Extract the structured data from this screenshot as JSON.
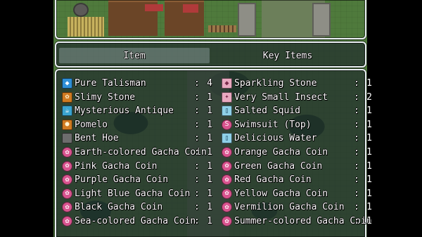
{
  "menu": {
    "tabs": [
      {
        "label": "Item"
      },
      {
        "label": "Key Items"
      }
    ],
    "separator": ":",
    "left_column": [
      {
        "name": "Pure Talisman",
        "qty": "4",
        "icon": "talisman-icon",
        "glyph": "◆",
        "color_class": "blue"
      },
      {
        "name": "Slimy Stone",
        "qty": "1",
        "icon": "slimy-stone-icon",
        "glyph": "✿",
        "color_class": "orange"
      },
      {
        "name": "Mysterious Antique",
        "qty": "1",
        "icon": "teapot-icon",
        "glyph": "☕",
        "color_class": "teal"
      },
      {
        "name": "Pomelo",
        "qty": "1",
        "icon": "fruit-icon",
        "glyph": "●",
        "color_class": "orange"
      },
      {
        "name": "Bent Hoe",
        "qty": "1",
        "icon": "hoe-icon",
        "glyph": "",
        "color_class": "grey"
      },
      {
        "name": "Earth-colored Gacha Coin",
        "qty": "1",
        "icon": "gacha-coin-icon",
        "glyph": "✿",
        "color_class": "coin"
      },
      {
        "name": "Pink Gacha Coin",
        "qty": "1",
        "icon": "gacha-coin-icon",
        "glyph": "✿",
        "color_class": "coin"
      },
      {
        "name": "Purple Gacha Coin",
        "qty": "1",
        "icon": "gacha-coin-icon",
        "glyph": "✿",
        "color_class": "coin"
      },
      {
        "name": "Light Blue Gacha Coin",
        "qty": "1",
        "icon": "gacha-coin-icon",
        "glyph": "✿",
        "color_class": "coin"
      },
      {
        "name": "Black Gacha Coin",
        "qty": "1",
        "icon": "gacha-coin-icon",
        "glyph": "✿",
        "color_class": "coin"
      },
      {
        "name": "Sea-colored Gacha Coin",
        "qty": "1",
        "icon": "gacha-coin-icon",
        "glyph": "✿",
        "color_class": "coin"
      }
    ],
    "right_column": [
      {
        "name": "Sparkling Stone",
        "qty": "1",
        "icon": "sparkling-stone-icon",
        "glyph": "◆",
        "color_class": "pinkbox"
      },
      {
        "name": "Very Small Insect",
        "qty": "2",
        "icon": "insect-icon",
        "glyph": "✦",
        "color_class": "pinkbox"
      },
      {
        "name": "Salted Squid",
        "qty": "1",
        "icon": "jar-icon",
        "glyph": "▯",
        "color_class": "bottle"
      },
      {
        "name": "Swimsuit (Top)",
        "qty": "1",
        "icon": "swimsuit-icon",
        "glyph": "S",
        "color_class": "coin"
      },
      {
        "name": "Delicious Water",
        "qty": "1",
        "icon": "bottle-icon",
        "glyph": "▯",
        "color_class": "bottle"
      },
      {
        "name": "Orange Gacha Coin",
        "qty": "1",
        "icon": "gacha-coin-icon",
        "glyph": "✿",
        "color_class": "coin"
      },
      {
        "name": "Green Gacha Coin",
        "qty": "1",
        "icon": "gacha-coin-icon",
        "glyph": "✿",
        "color_class": "coin"
      },
      {
        "name": "Red Gacha Coin",
        "qty": "1",
        "icon": "gacha-coin-icon",
        "glyph": "✿",
        "color_class": "coin"
      },
      {
        "name": "Yellow Gacha Coin",
        "qty": "1",
        "icon": "gacha-coin-icon",
        "glyph": "✿",
        "color_class": "coin"
      },
      {
        "name": "Vermilion Gacha Coin",
        "qty": "1",
        "icon": "gacha-coin-icon",
        "glyph": "✿",
        "color_class": "coin"
      },
      {
        "name": "Summer-colored Gacha Coin",
        "qty": "1",
        "icon": "gacha-coin-icon",
        "glyph": "✿",
        "color_class": "coin"
      }
    ]
  },
  "colors": {
    "window_border": "#e9eef2",
    "window_fill": "#1a222c",
    "selected_tab": "#becdd7",
    "coin_pink": "#d8538e",
    "text": "#ffffff"
  }
}
